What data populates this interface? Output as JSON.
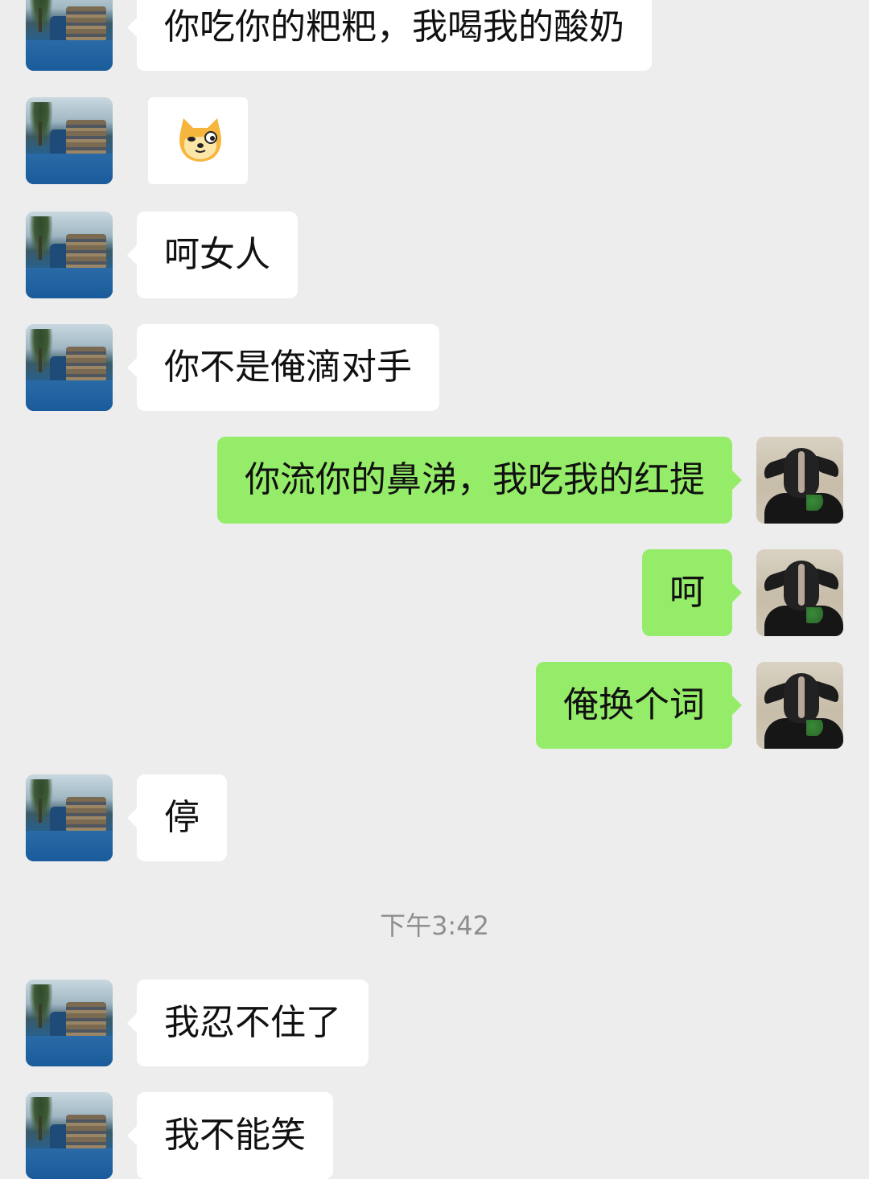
{
  "messages": [
    {
      "side": "left",
      "text": "你吃你的粑粑，我喝我的酸奶"
    },
    {
      "side": "left",
      "type": "sticker",
      "sticker": "doge-cat-emoji"
    },
    {
      "side": "left",
      "text": "呵女人"
    },
    {
      "side": "left",
      "text": "你不是俺滴对手"
    },
    {
      "side": "right",
      "text": "你流你的鼻涕，我吃我的红提"
    },
    {
      "side": "right",
      "text": "呵"
    },
    {
      "side": "right",
      "text": "俺换个词"
    },
    {
      "side": "left",
      "text": "停"
    },
    {
      "type": "timestamp",
      "text": "下午3:42"
    },
    {
      "side": "left",
      "text": "我忍不住了"
    },
    {
      "side": "left",
      "text": "我不能笑"
    }
  ],
  "colors": {
    "background": "#ededed",
    "incoming_bubble": "#ffffff",
    "outgoing_bubble": "#95ec69",
    "timestamp": "#8e8e8e"
  },
  "icons": {
    "incoming_avatar": "pool-scenery-avatar",
    "outgoing_avatar": "goat-avatar"
  }
}
